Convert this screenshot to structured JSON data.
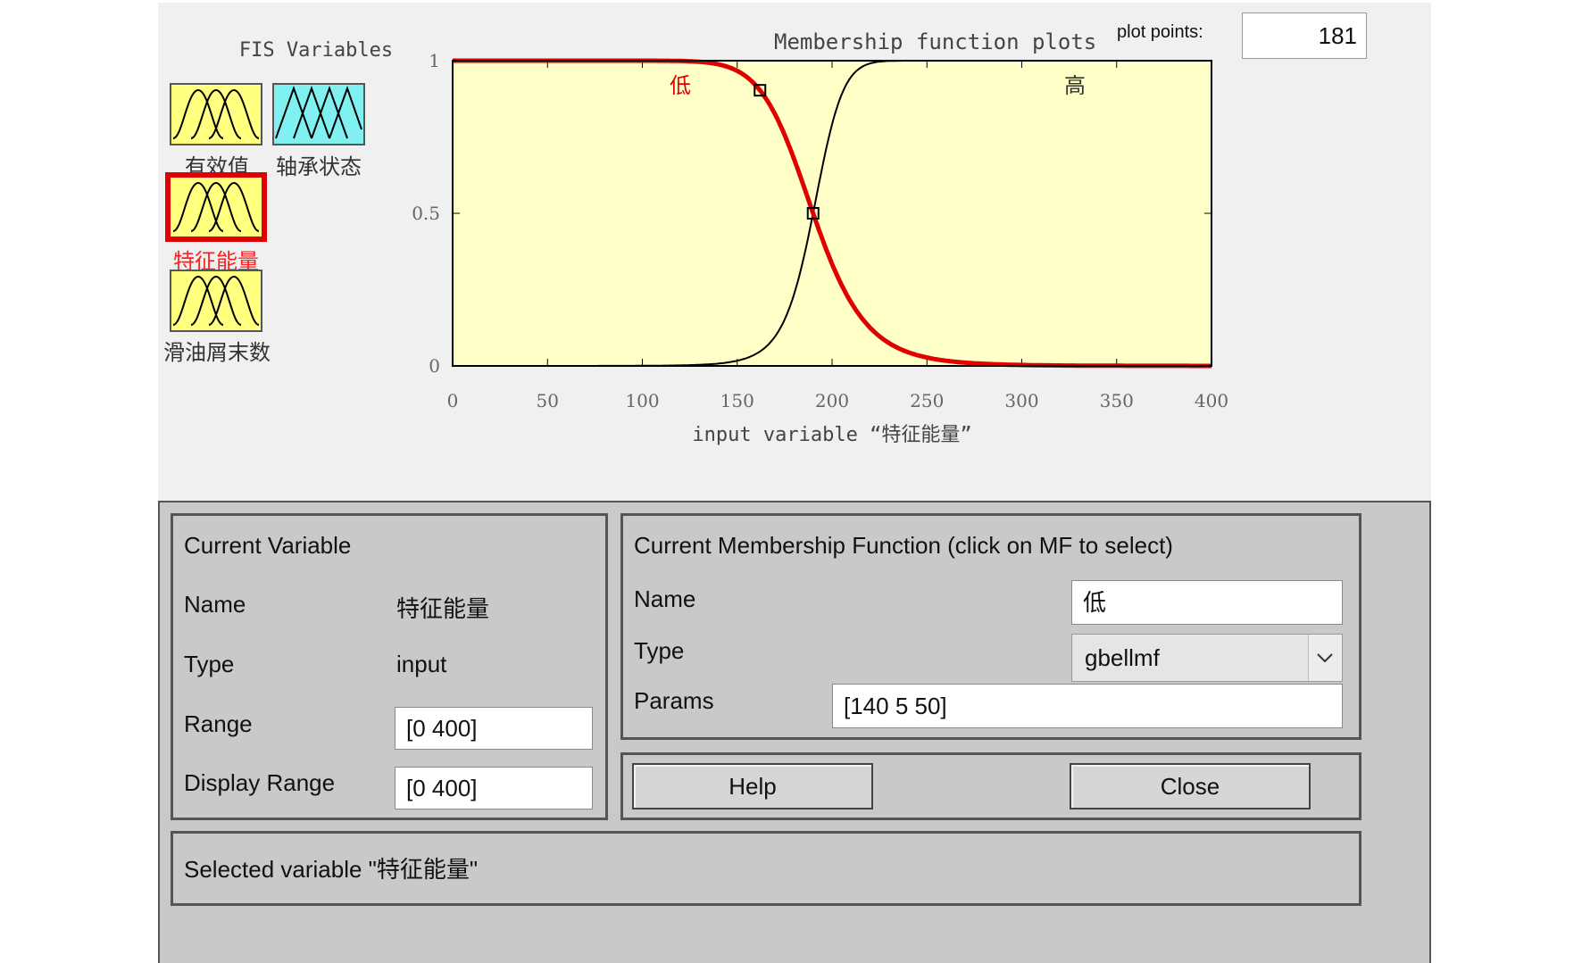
{
  "fis_panel": {
    "title": "FIS Variables",
    "variables": [
      {
        "label": "有效值",
        "color": "#ffff80",
        "icon": "gaussian-mf-icon",
        "selected": false
      },
      {
        "label": "轴承状态",
        "color": "#80f0f0",
        "icon": "triangle-mf-icon",
        "selected": false
      },
      {
        "label": "特征能量",
        "color": "#ffff80",
        "icon": "gaussian-mf-icon",
        "selected": true
      },
      {
        "label": "滑油屑末数",
        "color": "#ffff80",
        "icon": "gaussian-mf-icon",
        "selected": false
      }
    ]
  },
  "plot_header": {
    "title": "Membership function plots",
    "points_label": "plot points:",
    "points_value": "181"
  },
  "chart_data": {
    "type": "line",
    "xlabel": "input variable “特征能量”",
    "xlim": [
      0,
      400
    ],
    "ylim": [
      0,
      1
    ],
    "xticks": [
      "0",
      "50",
      "100",
      "150",
      "200",
      "250",
      "300",
      "350",
      "400"
    ],
    "yticks": [
      "0",
      "0.5",
      "1"
    ],
    "background": "#ffffc8",
    "series": [
      {
        "name": "低",
        "mf": "gbellmf",
        "params": [
          140,
          5,
          50
        ],
        "decreasing": true,
        "color": "#e00000",
        "selected": true
      },
      {
        "name": "高",
        "mf": "gbellmf",
        "params": [
          80,
          5,
          270
        ],
        "decreasing": false,
        "color": "#000000",
        "selected": false
      }
    ]
  },
  "current_variable": {
    "title": "Current Variable",
    "name_label": "Name",
    "name_value": "特征能量",
    "type_label": "Type",
    "type_value": "input",
    "range_label": "Range",
    "range_value": "[0 400]",
    "display_range_label": "Display Range",
    "display_range_value": "[0 400]"
  },
  "current_mf": {
    "title": "Current Membership Function (click on MF to select)",
    "name_label": "Name",
    "name_value": "低",
    "type_label": "Type",
    "type_value": "gbellmf",
    "params_label": "Params",
    "params_value": "[140 5 50]"
  },
  "buttons": {
    "help": "Help",
    "close": "Close"
  },
  "status": {
    "text": "Selected variable \"特征能量\""
  }
}
